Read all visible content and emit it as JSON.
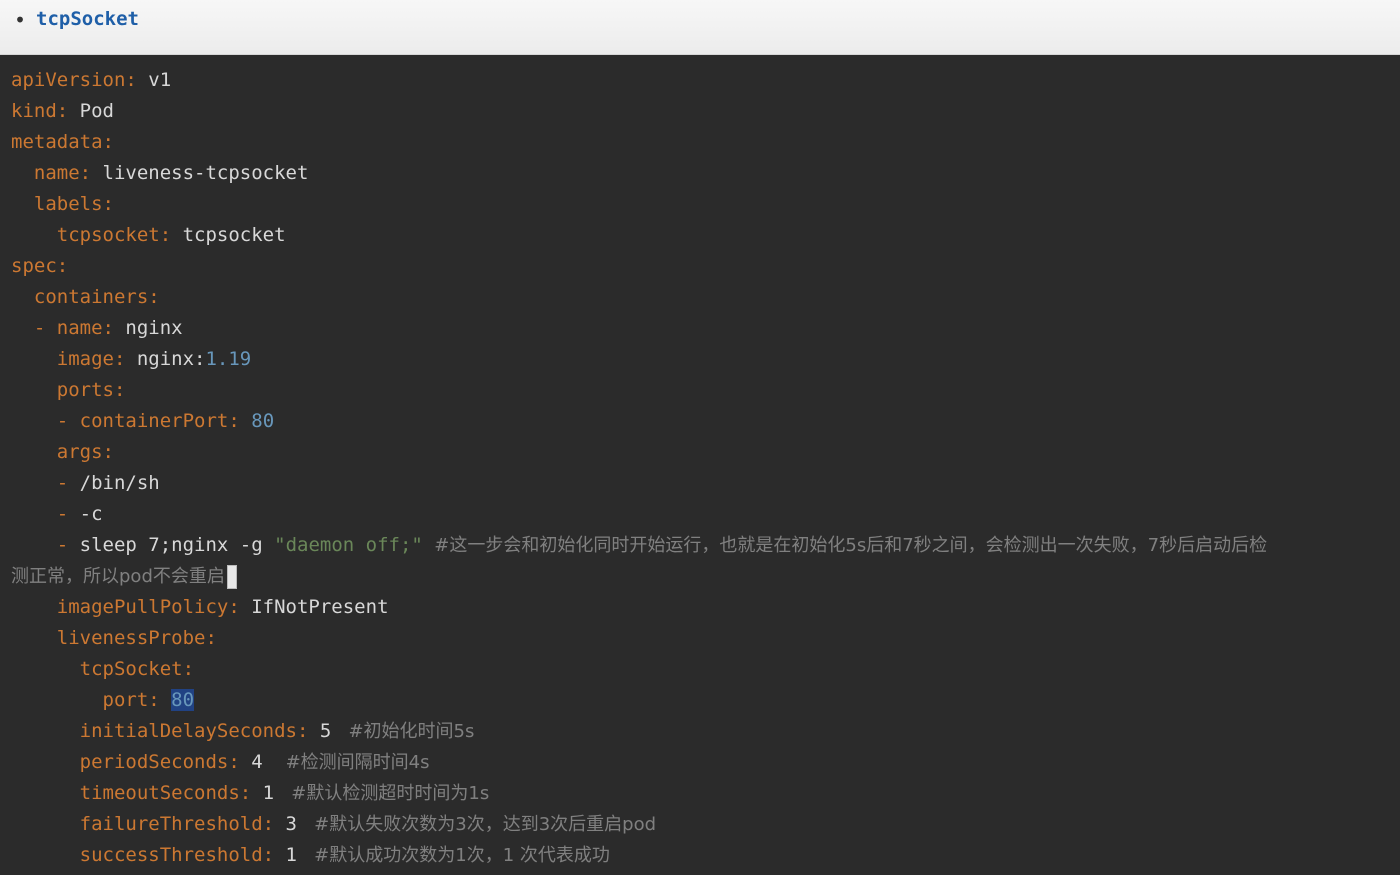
{
  "header": {
    "bullet": "•",
    "title": "tcpSocket"
  },
  "code": {
    "l1_key": "apiVersion:",
    "l1_val": " v1",
    "l2_key": "kind:",
    "l2_val": " Pod",
    "l3_key": "metadata:",
    "l4_key": "name:",
    "l4_val": " liveness-tcpsocket",
    "l5_key": "labels:",
    "l6_key": "tcpsocket:",
    "l6_val": " tcpsocket",
    "l7_key": "spec:",
    "l8_key": "containers:",
    "l9_dash": "- ",
    "l9_key": "name:",
    "l9_val": " nginx",
    "l10_key": "image:",
    "l10_val": " nginx:",
    "l10_num": "1.19",
    "l11_key": "ports:",
    "l12_dash": "- ",
    "l12_key": "containerPort:",
    "l12_num": " 80",
    "l13_key": "args:",
    "l14_dash": "- ",
    "l14_val": "/bin/sh",
    "l15_dash": "- ",
    "l15_val": "-c",
    "l16_dash": "- ",
    "l16_val": "sleep 7;nginx -g ",
    "l16_str": "\"daemon off;\"",
    "l16_comment": "  #这一步会和初始化同时开始运行，也就是在初始化5s后和7秒之间，会检测出一次失败，7秒后启动后检",
    "l17_comment": "测正常，所以pod不会重启",
    "l18_key": "imagePullPolicy:",
    "l18_val": " IfNotPresent",
    "l19_key": "livenessProbe:",
    "l20_key": "tcpSocket:",
    "l21_key": "port:",
    "l21_num": "80",
    "l22_key": "initialDelaySeconds:",
    "l22_val": " 5",
    "l22_comment": "   #初始化时间5s",
    "l23_key": "periodSeconds:",
    "l23_val": " 4",
    "l23_comment": "    #检测间隔时间4s",
    "l24_key": "timeoutSeconds:",
    "l24_val": " 1",
    "l24_comment": "   #默认检测超时时间为1s",
    "l25_key": "failureThreshold:",
    "l25_val": " 3",
    "l25_comment": "   #默认失败次数为3次，达到3次后重启pod",
    "l26_key": "successThreshold:",
    "l26_val": " 1",
    "l26_comment": "   #默认成功次数为1次，1 次代表成功"
  },
  "colors": {
    "background": "#2b2b2b",
    "key": "#cc7832",
    "number": "#6897bb",
    "string": "#6a8759",
    "comment": "#808080",
    "header_title": "#1f5fa8"
  }
}
